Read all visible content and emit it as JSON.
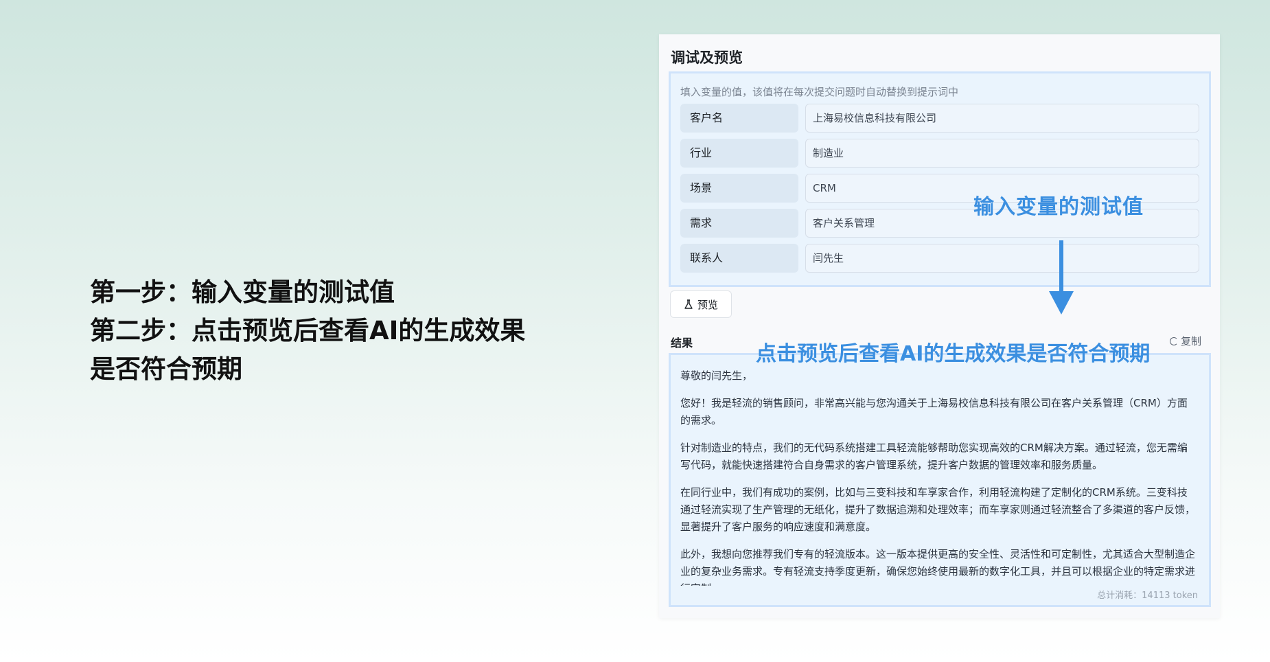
{
  "steps": {
    "line1": "第一步：输入变量的测试值",
    "line2": "第二步：点击预览后查看AI的生成效果是否符合预期"
  },
  "panel": {
    "title": "调试及预览",
    "hint": "填入变量的值，该值将在每次提交问题时自动替换到提示词中",
    "variables": [
      {
        "label": "客户名",
        "value": "上海易校信息科技有限公司"
      },
      {
        "label": "行业",
        "value": "制造业"
      },
      {
        "label": "场景",
        "value": "CRM"
      },
      {
        "label": "需求",
        "value": "客户关系管理"
      },
      {
        "label": "联系人",
        "value": "闫先生"
      }
    ],
    "preview_label": "预览",
    "result_label": "结果",
    "copy_label": "复制",
    "result_paragraphs": [
      "尊敬的闫先生，",
      "您好！我是轻流的销售顾问，非常高兴能与您沟通关于上海易校信息科技有限公司在客户关系管理（CRM）方面的需求。",
      "针对制造业的特点，我们的无代码系统搭建工具轻流能够帮助您实现高效的CRM解决方案。通过轻流，您无需编写代码，就能快速搭建符合自身需求的客户管理系统，提升客户数据的管理效率和服务质量。",
      "在同行业中，我们有成功的案例，比如与三变科技和车享家合作，利用轻流构建了定制化的CRM系统。三变科技通过轻流实现了生产管理的无纸化，提升了数据追溯和处理效率；而车享家则通过轻流整合了多渠道的客户反馈，显著提升了客户服务的响应速度和满意度。",
      "此外，我想向您推荐我们专有的轻流版本。这一版本提供更高的安全性、灵活性和可定制性，尤其适合大型制造企业的复杂业务需求。专有轻流支持季度更新，确保您始终使用最新的数字化工具，并且可以根据企业的特定需求进行定制。"
    ],
    "token_info": "总计消耗：14113 token"
  },
  "annotations": {
    "input_hint": "输入变量的测试值",
    "preview_hint": "点击预览后查看AI的生成效果是否符合预期"
  },
  "colors": {
    "accent": "#3b8fe0",
    "box_bg": "#eaf4fd",
    "box_border": "#cfe3fb"
  },
  "icons": {
    "preview": "flask-icon",
    "copy": "copy-icon",
    "arrow": "arrow-down-icon"
  }
}
